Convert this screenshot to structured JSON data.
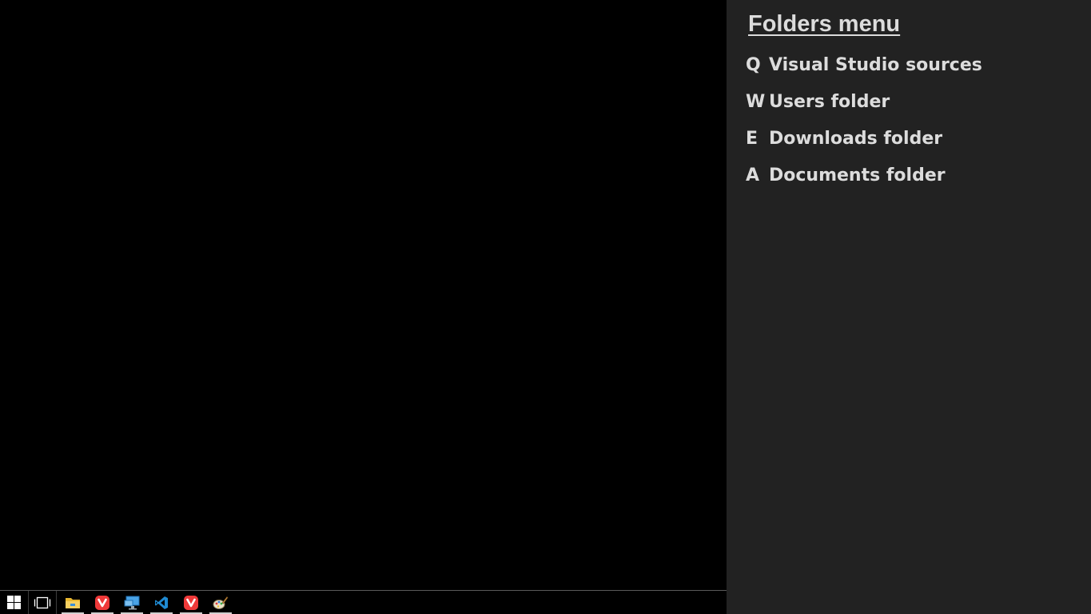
{
  "menu": {
    "title": "Folders menu",
    "items": [
      {
        "key": "Q",
        "label": "Visual Studio sources"
      },
      {
        "key": "W",
        "label": "Users folder"
      },
      {
        "key": "E",
        "label": "Downloads folder"
      },
      {
        "key": "A",
        "label": "Documents folder"
      }
    ]
  },
  "colors": {
    "panel_background": "#222222",
    "menu_text": "#dcdcdc",
    "desktop_background": "#000000",
    "vivaldi_red": "#ef3939",
    "vscode_blue": "#1f8ad2"
  },
  "taskbar": {
    "icons": [
      "windows-start-icon",
      "task-view-icon",
      "file-explorer-icon",
      "vivaldi-icon",
      "remote-desktop-icon",
      "vscode-icon",
      "vivaldi-icon",
      "paint-icon"
    ]
  }
}
